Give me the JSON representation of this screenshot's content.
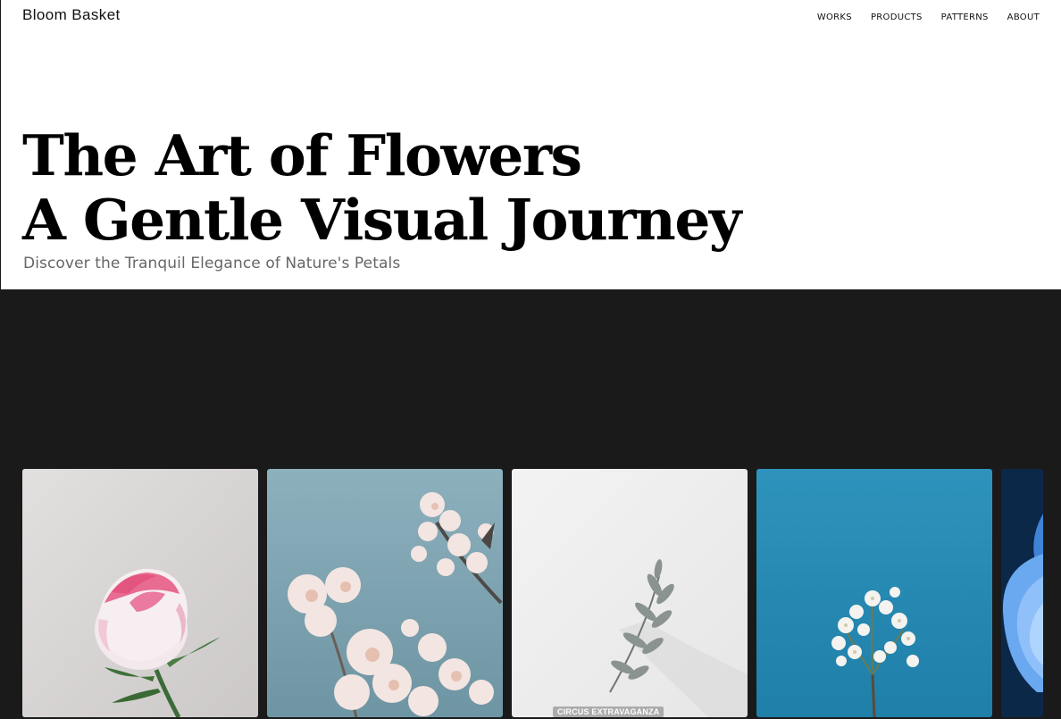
{
  "brand": {
    "name": "Bloom Basket"
  },
  "nav": {
    "items": [
      {
        "label": "WORKS"
      },
      {
        "label": "PRODUCTS"
      },
      {
        "label": "PATTERNS"
      },
      {
        "label": "ABOUT"
      }
    ]
  },
  "hero": {
    "title_line1": "The Art of Flowers",
    "title_line2": "A Gentle Visual Journey",
    "subtitle": "Discover the Tranquil Elegance of Nature's Petals"
  },
  "gallery": {
    "cards": [
      {
        "subject": "pink-rose",
        "background": "#d9d7d6"
      },
      {
        "subject": "blossom-branch",
        "background": "#7ea3b0"
      },
      {
        "subject": "silver-leaves",
        "background": "#efefef",
        "label": "CIRCUS EXTRAVAGANZA"
      },
      {
        "subject": "white-blossom",
        "background": "#2b8fb8"
      },
      {
        "subject": "blue-petal",
        "background": "#0d2a4a"
      }
    ]
  }
}
